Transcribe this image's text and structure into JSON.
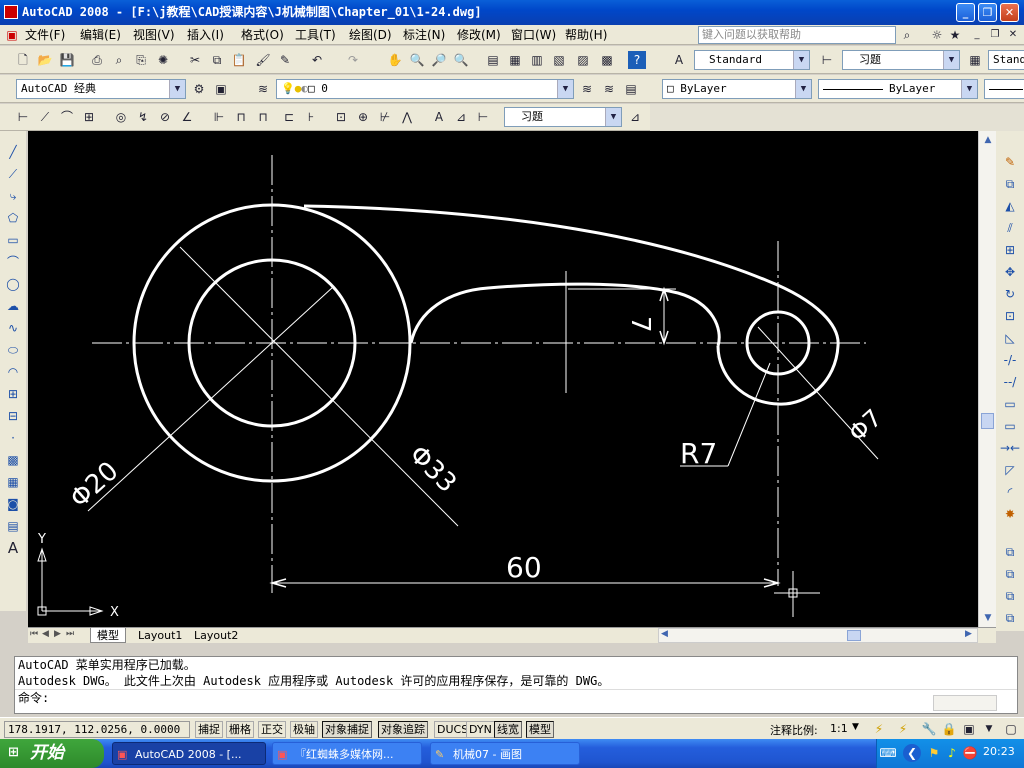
{
  "window": {
    "title": "AutoCAD 2008 - [F:\\j教程\\CAD授课内容\\J机械制图\\Chapter_01\\1-24.dwg]",
    "minimize": "_",
    "restore": "❐",
    "close": "✕"
  },
  "menu": {
    "items": [
      "文件(F)",
      "编辑(E)",
      "视图(V)",
      "插入(I)",
      "格式(O)",
      "工具(T)",
      "绘图(D)",
      "标注(N)",
      "修改(M)",
      "窗口(W)",
      "帮助(H)"
    ],
    "help_placeholder": "键入问题以获取帮助",
    "doc_min": "_",
    "doc_restore": "❐",
    "doc_close": "✕"
  },
  "toolbar": {
    "text_style": "Standard",
    "dim_style": "习题",
    "table_style_partial": "Stand",
    "workspace": "AutoCAD 经典",
    "layer": "0",
    "color": "ByLayer",
    "linetype": "ByLayer",
    "dim_style_2": "习题"
  },
  "drawing": {
    "dim_diameter_20": "Φ20",
    "dim_diameter_33": "Φ33",
    "dim_radius_7": "R7",
    "dim_diameter_7": "Φ7",
    "dim_linear_60": "60",
    "dim_vertical_7": "7",
    "ucs_x": "X",
    "ucs_y": "Y"
  },
  "layout_tabs": [
    "模型",
    "Layout1",
    "Layout2"
  ],
  "command": {
    "line1": "AutoCAD 菜单实用程序已加载。",
    "line2": "Autodesk DWG。  此文件上次由 Autodesk 应用程序或 Autodesk 许可的应用程序保存，是可靠的 DWG。",
    "prompt": "命令:"
  },
  "status": {
    "coords": "178.1917, 112.0256, 0.0000",
    "toggles": [
      {
        "label": "捕捉",
        "on": false
      },
      {
        "label": "栅格",
        "on": false
      },
      {
        "label": "正交",
        "on": false
      },
      {
        "label": "极轴",
        "on": false
      },
      {
        "label": "对象捕捉",
        "on": true
      },
      {
        "label": "对象追踪",
        "on": true
      },
      {
        "label": "DUCS",
        "on": false
      },
      {
        "label": "DYN",
        "on": false
      },
      {
        "label": "线宽",
        "on": true
      },
      {
        "label": "模型",
        "on": true
      }
    ],
    "annotation_scale_label": "注释比例:",
    "annotation_scale": "1:1"
  },
  "taskbar": {
    "start": "开始",
    "tasks": [
      "AutoCAD 2008 - [...",
      "『红蜘蛛多媒体网...",
      "机械07 - 画图"
    ],
    "clock": "20:23"
  },
  "colors": {
    "canvas": "#000000",
    "titlebar": "#0a5fd8",
    "taskbar": "#245edc",
    "start_button": "#3fa63c"
  }
}
